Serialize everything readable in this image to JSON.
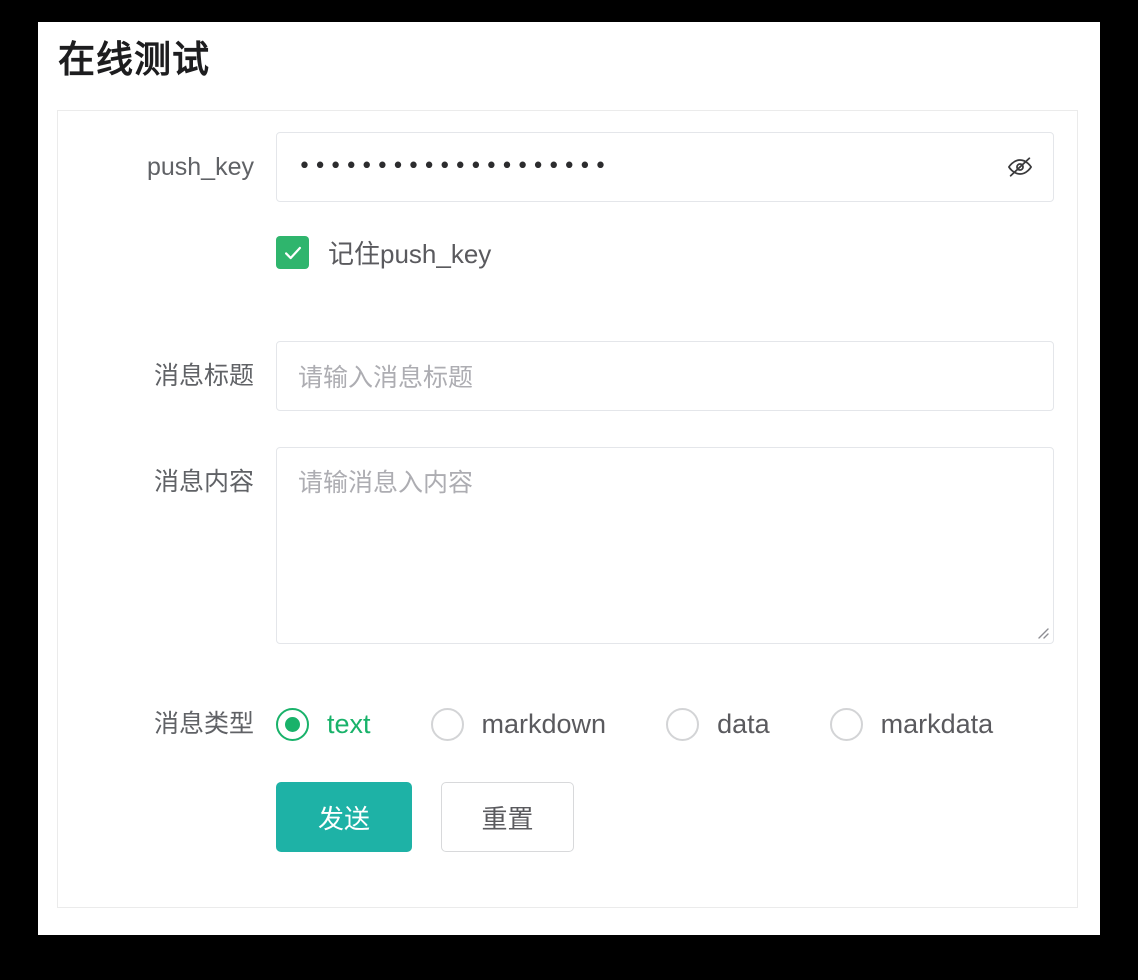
{
  "page": {
    "title": "在线测试"
  },
  "form": {
    "push_key": {
      "label": "push_key",
      "value": "••••••••••••••••••••",
      "masked": true,
      "toggle_icon": "eye-off-icon"
    },
    "remember": {
      "label": "记住push_key",
      "checked": true,
      "check_color": "#2fb56d"
    },
    "message_title": {
      "label": "消息标题",
      "value": "",
      "placeholder": "请输入消息标题"
    },
    "message_content": {
      "label": "消息内容",
      "value": "",
      "placeholder": "请输消息入内容"
    },
    "message_type": {
      "label": "消息类型",
      "selected": "text",
      "accent_color": "#19b26a",
      "options": [
        {
          "label": "text",
          "checked": true
        },
        {
          "label": "markdown",
          "checked": false
        },
        {
          "label": "data",
          "checked": false
        },
        {
          "label": "markdata",
          "checked": false
        }
      ]
    },
    "actions": {
      "submit_label": "发送",
      "reset_label": "重置",
      "submit_color": "#1eb2a6"
    }
  }
}
